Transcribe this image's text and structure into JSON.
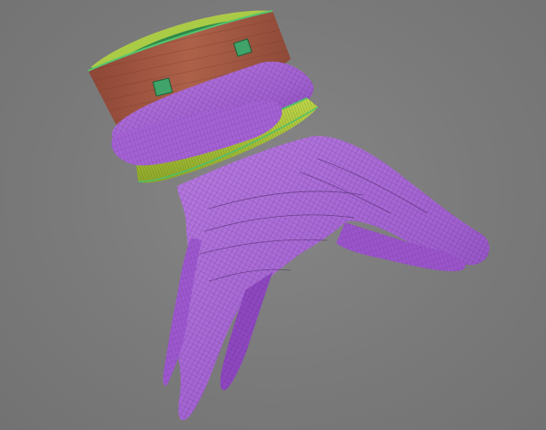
{
  "viewport": {
    "background_color": "#7a7a7a",
    "subject": "glove-mesh-model"
  },
  "model": {
    "colors": {
      "glove_fill": "#a65fd6",
      "glove_shadow": "#7a3aa8",
      "wire_line": "#3c1f55",
      "cuff_band_fill": "#a4c23a",
      "cuff_band_edge": "#4fbf6a",
      "sleeve_fill": "#a85a45",
      "sleeve_inner": "#2f8a4a",
      "sleeve_inner_top": "#b7d245",
      "patch_fill": "#3fa36a"
    }
  }
}
